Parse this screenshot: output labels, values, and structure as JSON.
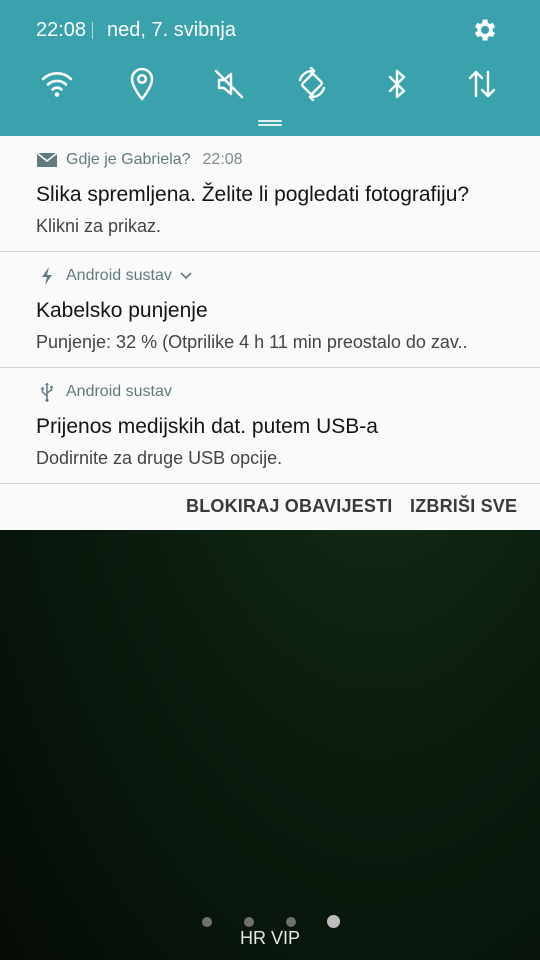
{
  "status": {
    "time": "22:08",
    "date": "ned, 7. svibnja"
  },
  "quick_toggles": [
    "wifi-icon",
    "location-icon",
    "sound-muted-icon",
    "auto-rotate-icon",
    "bluetooth-icon",
    "mobile-data-icon"
  ],
  "notifications": [
    {
      "app": "Gdje je Gabriela?",
      "time": "22:08",
      "title": "Slika spremljena. Želite li pogledati fotografiju?",
      "body": "Klikni za prikaz.",
      "icon": "envelope-icon"
    },
    {
      "app": "Android sustav",
      "title": "Kabelsko punjenje",
      "body": "Punjenje: 32 % (Otprilike 4 h 11 min preostalo do zav..",
      "icon": "charging-bolt-icon"
    },
    {
      "app": "Android sustav",
      "title": "Prijenos medijskih dat. putem USB-a",
      "body": "Dodirnite za druge USB opcije.",
      "icon": "usb-icon"
    }
  ],
  "actions": {
    "block": "BLOKIRAJ OBAVIJESTI",
    "clear": "IZBRIŠI SVE"
  },
  "home": {
    "carrier": "HR VIP",
    "page_count": 4,
    "active_page": 4
  },
  "colors": {
    "shade": "#3aa2ad",
    "panel": "#fafafa",
    "app_label": "#607b80"
  }
}
